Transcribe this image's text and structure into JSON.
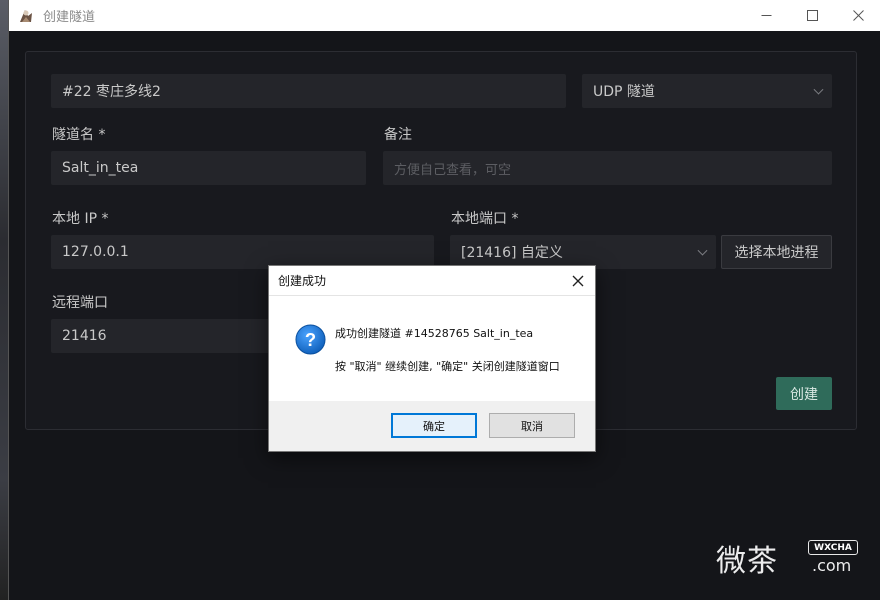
{
  "window": {
    "title": "创建隧道"
  },
  "form": {
    "node_value": "#22 枣庄多线2",
    "type_value": "UDP 隧道",
    "tunnel_name_label": "隧道名 *",
    "tunnel_name_value": "Salt_in_tea",
    "remark_label": "备注",
    "remark_placeholder": "方便自己查看，可空",
    "local_ip_label": "本地 IP *",
    "local_ip_value": "127.0.0.1",
    "local_port_label": "本地端口 *",
    "local_port_value": "[21416] 自定义",
    "select_process_label": "选择本地进程",
    "remote_port_label": "远程端口",
    "remote_port_value": "21416",
    "create_label": "创建"
  },
  "dialog": {
    "title": "创建成功",
    "message_line1": "成功创建隧道 #14528765 Salt_in_tea",
    "message_line2": "按 \"取消\" 继续创建, \"确定\" 关闭创建隧道窗口",
    "ok_label": "确定",
    "cancel_label": "取消",
    "icon": "question-icon"
  },
  "watermark": {
    "text": "微茶",
    "badge": "WXCHA",
    "domain": ".com"
  },
  "colors": {
    "accent": "#2f6b5a",
    "window_bg": "#141519",
    "field_bg": "#24252a",
    "dialog_primary_border": "#0078d7",
    "question_icon": "#1a6fc7"
  }
}
